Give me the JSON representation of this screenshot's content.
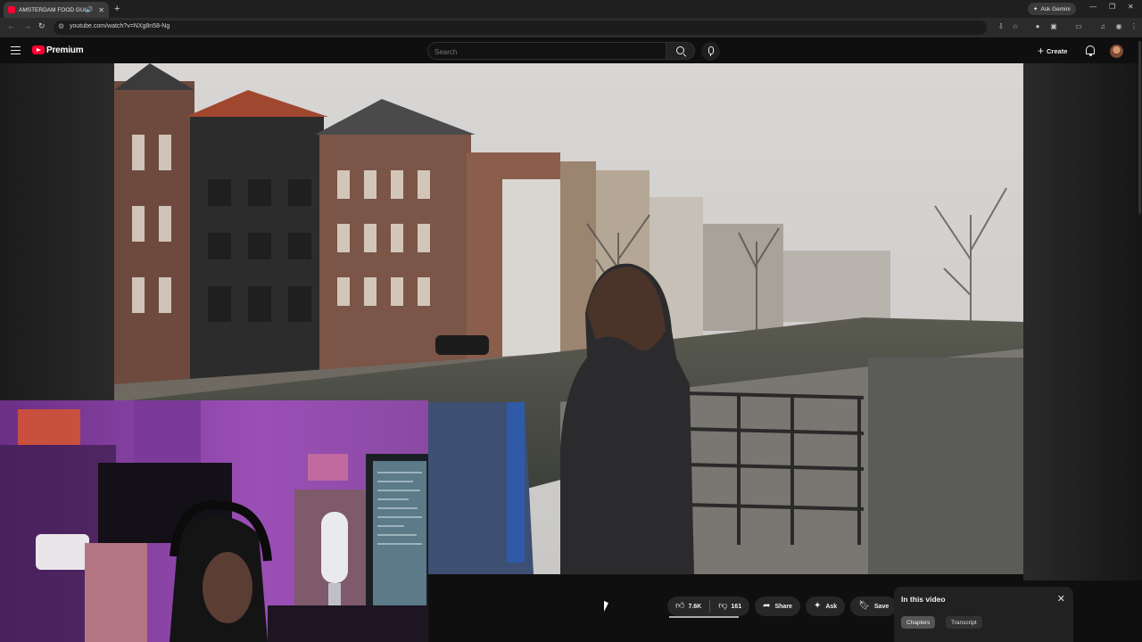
{
  "browser": {
    "tab_title": "AMSTERDAM FOOD GUIDE",
    "url": "youtube.com/watch?v=NXg8n58-Ng",
    "ask_gemini": "Ask Gemini",
    "new_tab_glyph": "+",
    "win_min": "—",
    "win_restore": "❐",
    "win_close": "✕"
  },
  "header": {
    "brand": "Premium",
    "search_placeholder": "Search",
    "create_label": "Create"
  },
  "actions": {
    "like_count": "7.6K",
    "dislike_count": "161",
    "share_label": "Share",
    "ask_label": "Ask",
    "save_label": "Save",
    "more_glyph": "•••"
  },
  "panel": {
    "title": "In this video",
    "chips": [
      "Chapters",
      "Transcript"
    ]
  },
  "colors": {
    "brand_red": "#ff0033",
    "background": "#0f0f0f",
    "chip_bg": "#272727"
  }
}
